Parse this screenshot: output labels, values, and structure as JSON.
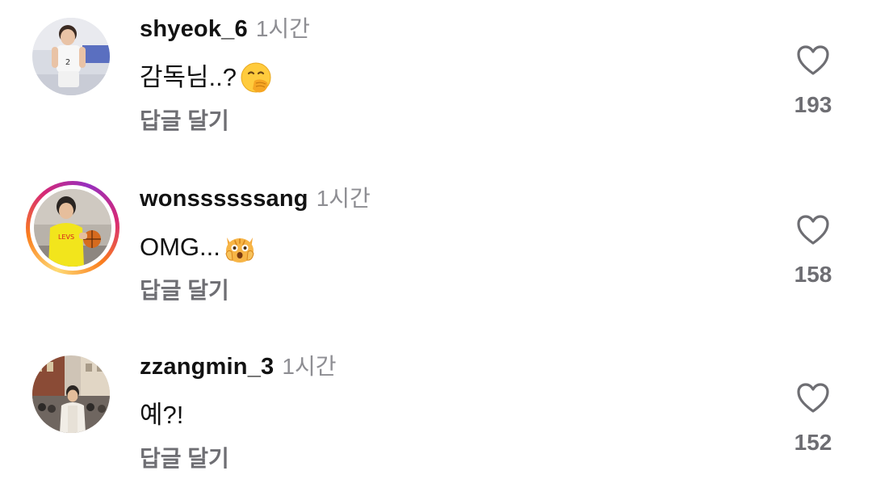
{
  "comments": [
    {
      "username": "shyeok_6",
      "time": "1시간",
      "text": "감독님..?",
      "emoji": "hand-over-mouth-emoji",
      "reply_label": "답글 달기",
      "like_icon": "heart-outline-icon",
      "like_count": "193",
      "avatar": "avatar-player-white-jersey",
      "story_ring": false
    },
    {
      "username": "wonssssssang",
      "time": "1시간",
      "text": "OMG...",
      "emoji": "weary-cat-emoji",
      "reply_label": "답글 달기",
      "like_icon": "heart-outline-icon",
      "like_count": "158",
      "avatar": "avatar-player-yellow-shirt",
      "story_ring": true
    },
    {
      "username": "zzangmin_3",
      "time": "1시간",
      "text": "예?!",
      "emoji": "",
      "reply_label": "답글 달기",
      "like_icon": "heart-outline-icon",
      "like_count": "152",
      "avatar": "avatar-street-photo",
      "story_ring": false
    }
  ],
  "colors": {
    "username": "#121212",
    "secondary_text": "#6e6e73",
    "time": "#8e8e93",
    "story_ring": [
      "#feda75",
      "#fa7e1e",
      "#d62976",
      "#962fbf"
    ]
  }
}
